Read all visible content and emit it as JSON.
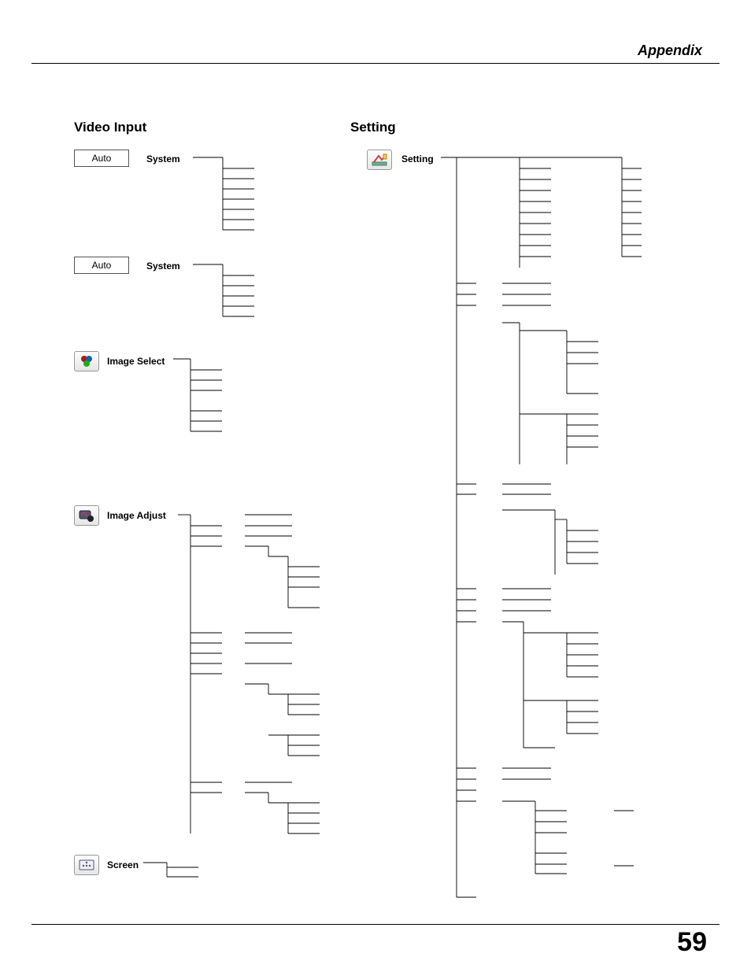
{
  "header": {
    "title": "Appendix"
  },
  "page": {
    "number": "59"
  },
  "sections": {
    "left": {
      "title": "Video Input"
    },
    "right": {
      "title": "Setting"
    }
  },
  "left_items": {
    "system1": {
      "label": "System",
      "box": "Auto"
    },
    "system2": {
      "label": "System",
      "box": "Auto"
    },
    "image_select": {
      "label": "Image Select"
    },
    "image_adjust": {
      "label": "Image Adjust"
    },
    "screen": {
      "label": "Screen"
    }
  },
  "right_items": {
    "setting": {
      "label": "Setting"
    }
  }
}
